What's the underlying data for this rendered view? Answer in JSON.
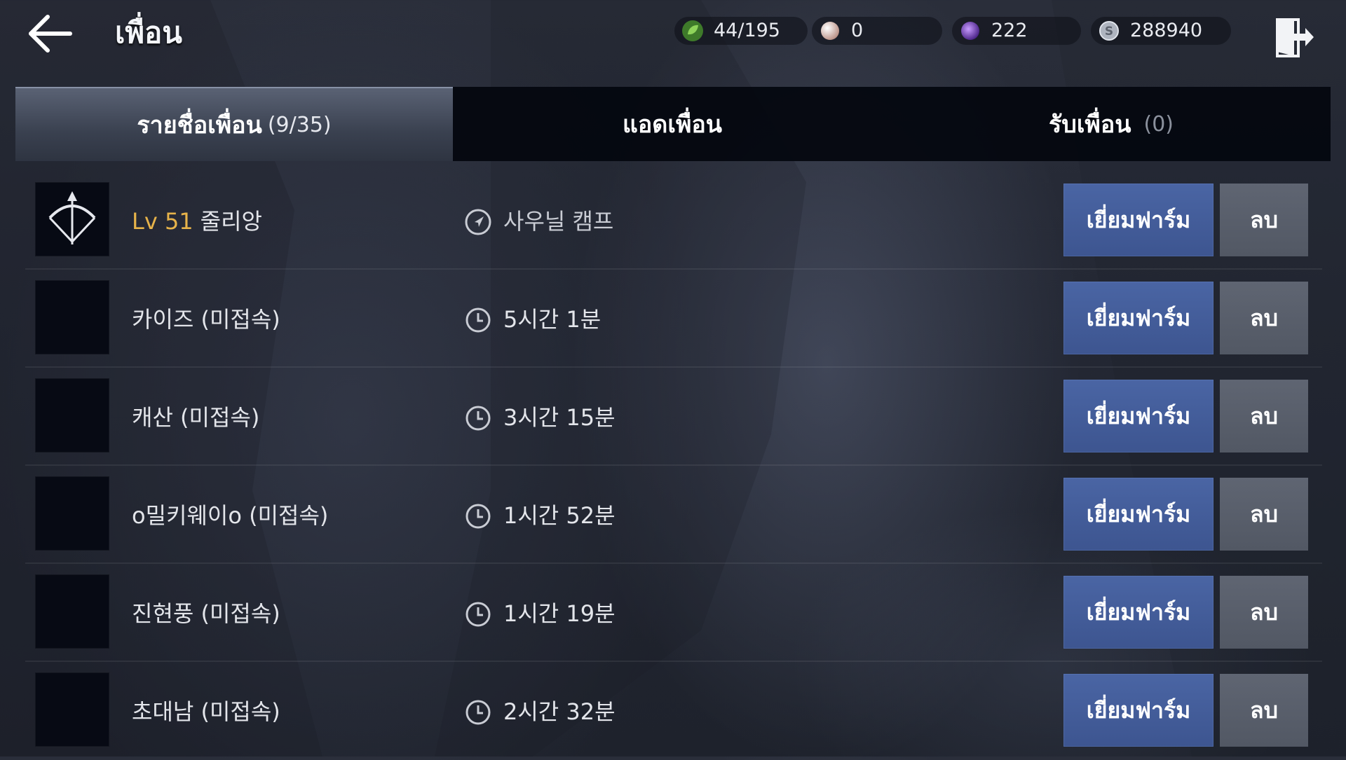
{
  "header": {
    "title": "เพื่อน",
    "back_icon": "back-arrow-icon",
    "exit_icon": "exit-door-icon"
  },
  "currencies": [
    {
      "name": "stamina",
      "icon": "green-leaf-icon",
      "value": "44/195",
      "color": "#6bbf3f"
    },
    {
      "name": "pearl",
      "icon": "pearl-icon",
      "value": "0",
      "color": "#d9b9b0"
    },
    {
      "name": "gem",
      "icon": "purple-orb-icon",
      "value": "222",
      "color": "#7a3fd0"
    },
    {
      "name": "silver",
      "icon": "silver-coin-icon",
      "value": "288940",
      "color": "#b7bcc6"
    }
  ],
  "tabs": [
    {
      "label": "รายชื่อเพื่อน",
      "count": "(9/35)",
      "active": true
    },
    {
      "label": "แอดเพื่อน",
      "count": "",
      "active": false
    },
    {
      "label": "รับเพื่อน",
      "count": "(0)",
      "active": false
    }
  ],
  "friends": [
    {
      "level": "Lv 51",
      "name": "줄리앙",
      "status_type": "location",
      "status": "사우닐 캠프",
      "avatar": "bow-class-icon"
    },
    {
      "level": "",
      "name": "카이즈 (미접속)",
      "status_type": "time",
      "status": "5시간 1분",
      "avatar": ""
    },
    {
      "level": "",
      "name": "캐산 (미접속)",
      "status_type": "time",
      "status": "3시간 15분",
      "avatar": ""
    },
    {
      "level": "",
      "name": "o밀키웨이o (미접속)",
      "status_type": "time",
      "status": "1시간 52분",
      "avatar": ""
    },
    {
      "level": "",
      "name": "진현풍 (미접속)",
      "status_type": "time",
      "status": "1시간 19분",
      "avatar": ""
    },
    {
      "level": "",
      "name": "초대남 (미접속)",
      "status_type": "time",
      "status": "2시간 32분",
      "avatar": ""
    }
  ],
  "buttons": {
    "visit_farm": "เยี่ยมฟาร์ม",
    "delete": "ลบ"
  },
  "colors": {
    "accent_blue": "#4a65a4",
    "level_gold": "#e7b34a",
    "delete_gray": "#5f6572"
  }
}
